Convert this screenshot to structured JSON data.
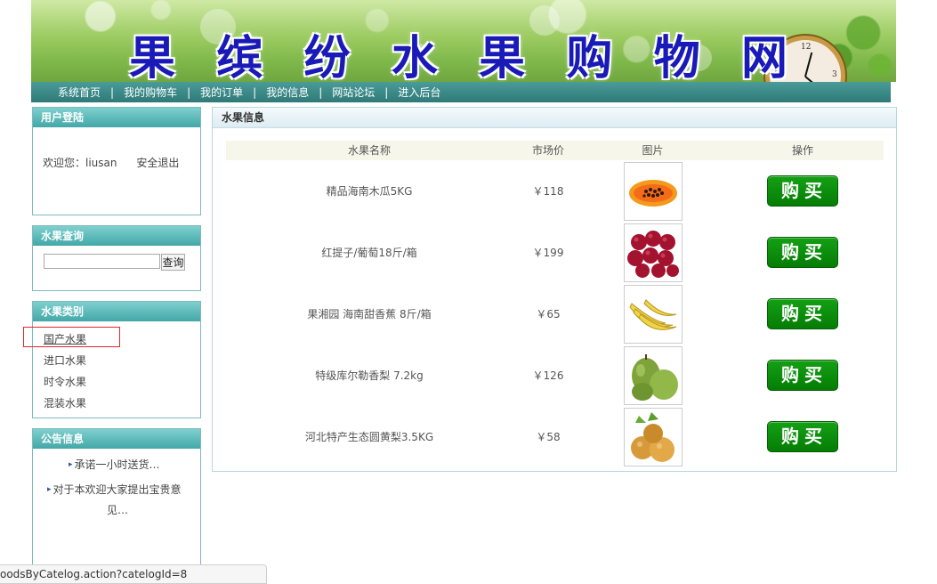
{
  "header": {
    "title_chars": [
      "果",
      "缤",
      "纷",
      "水",
      "果",
      "购",
      "物",
      "网"
    ]
  },
  "nav": {
    "items": [
      "系统首页",
      "我的购物车",
      "我的订单",
      "我的信息",
      "网站论坛",
      "进入后台"
    ],
    "separator": "|"
  },
  "login_panel": {
    "title": "用户登陆",
    "welcome": "欢迎您：liusan",
    "logout": "安全退出"
  },
  "search_panel": {
    "title": "水果查询",
    "input_value": "",
    "button": "查询"
  },
  "category_panel": {
    "title": "水果类别",
    "items": [
      "国产水果",
      "进口水果",
      "时令水果",
      "混装水果"
    ],
    "highlighted_index": 0
  },
  "notice_panel": {
    "title": "公告信息",
    "items": [
      "承诺一小时送货…",
      "对于本欢迎大家提出宝贵意",
      "见…"
    ]
  },
  "main": {
    "title": "水果信息",
    "columns": [
      "水果名称",
      "市场价",
      "图片",
      "操作"
    ],
    "buy_label": "购买",
    "rows": [
      {
        "name": "精品海南木瓜5KG",
        "price": "￥118",
        "image": "papaya-image"
      },
      {
        "name": "红提子/葡萄18斤/箱",
        "price": "￥199",
        "image": "red-grape-image"
      },
      {
        "name": "果湘园 海南甜香蕉 8斤/箱",
        "price": "￥65",
        "image": "banana-image"
      },
      {
        "name": "特级库尔勒香梨 7.2kg",
        "price": "￥126",
        "image": "korla-pear-image"
      },
      {
        "name": "河北特产生态圆黄梨3.5KG",
        "price": "￥58",
        "image": "yellow-pear-image"
      }
    ]
  },
  "status_bar": {
    "url": "oodsByCatelog.action?catelogId=8"
  },
  "colors": {
    "nav_bg": "#2f7a78",
    "panel_head": "#43a7a7",
    "buy_button": "#0a8a0a",
    "title_text": "#1a1ab8",
    "highlight_border": "#e0262b"
  }
}
